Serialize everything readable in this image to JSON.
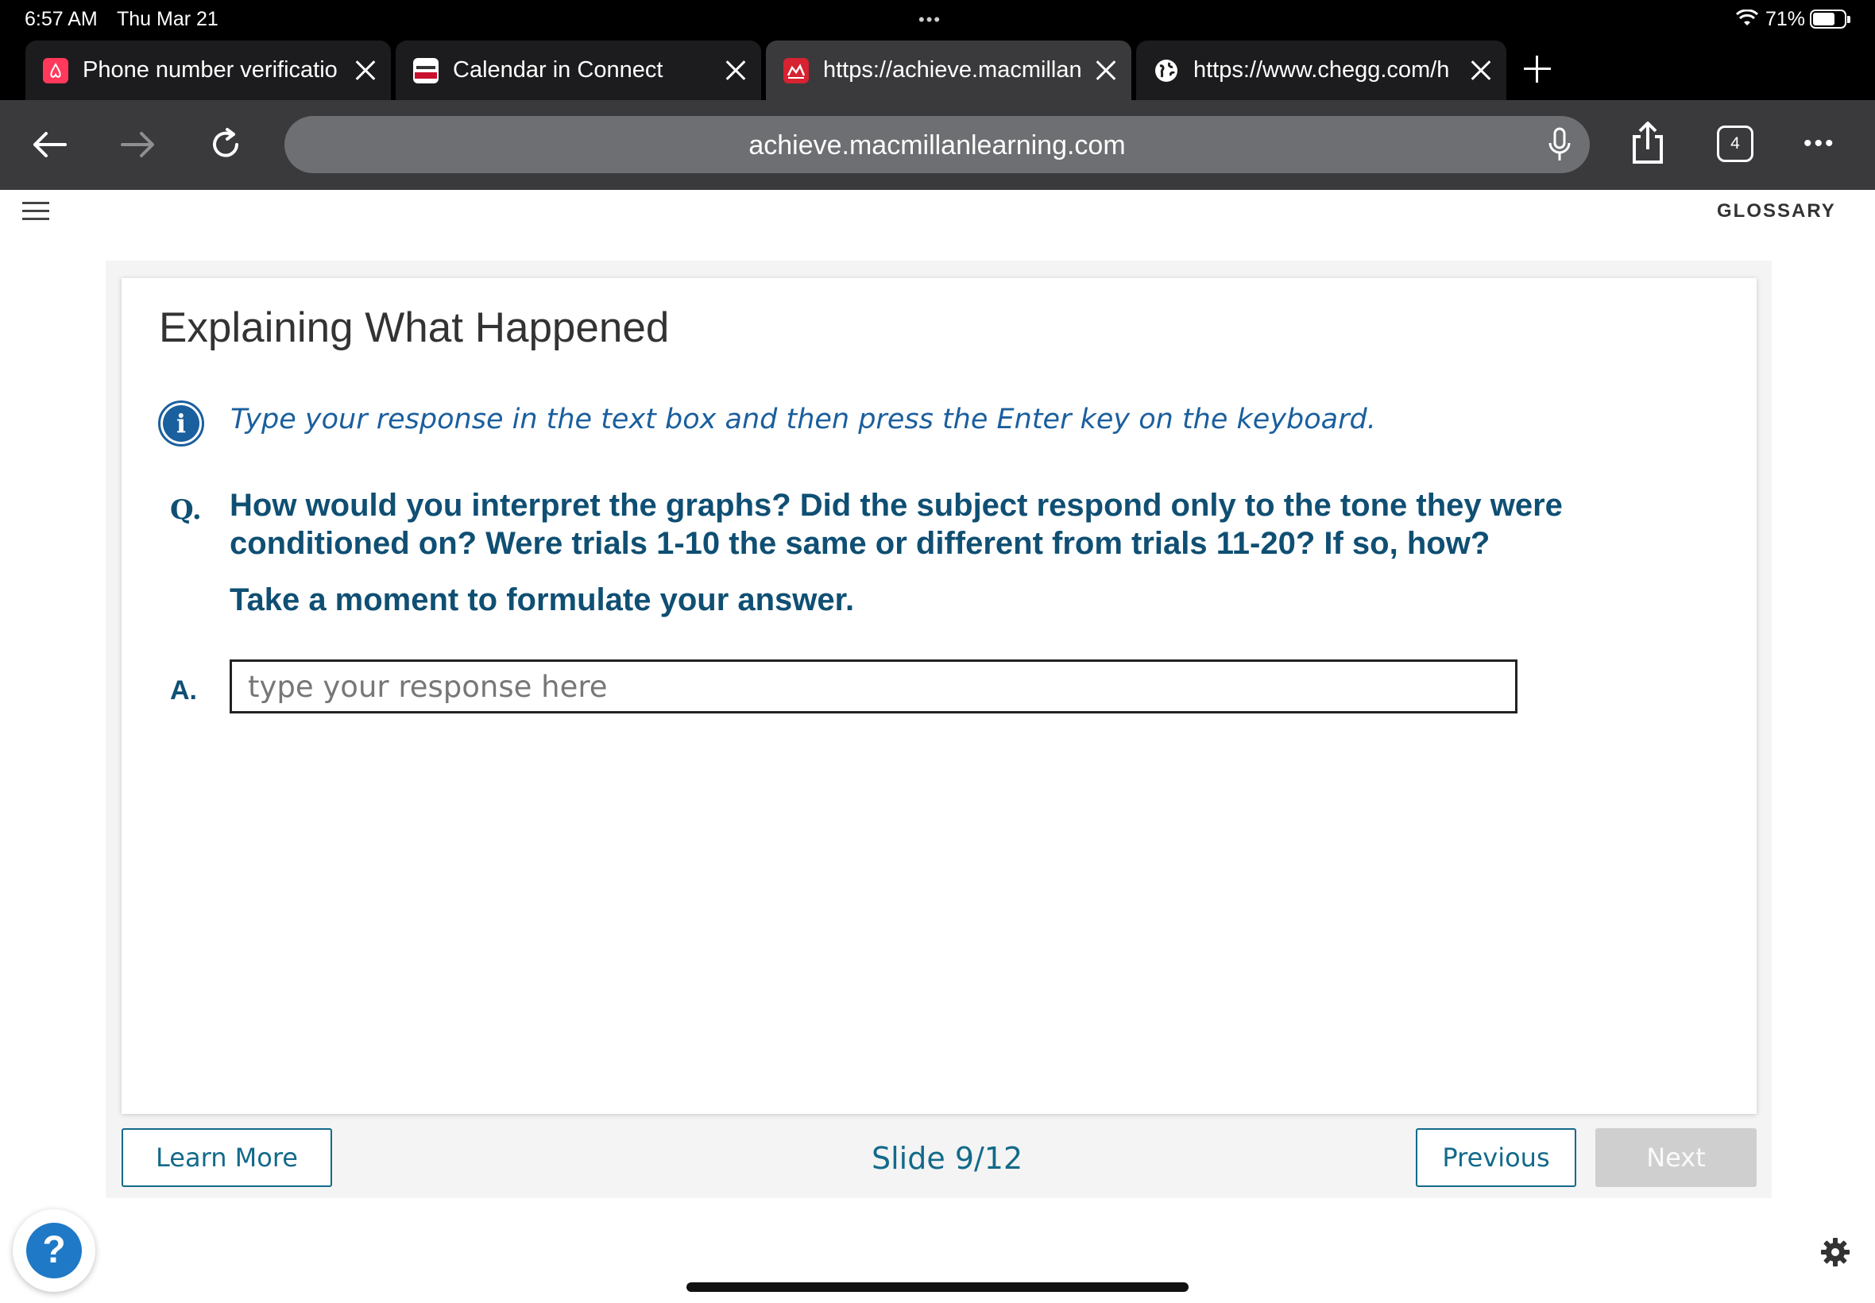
{
  "status_bar": {
    "time": "6:57 AM",
    "date": "Thu Mar 21",
    "center_dots": "•••",
    "battery_pct": "71%"
  },
  "tabs": [
    {
      "title": "Phone number verificatio",
      "icon": "airbnb-icon",
      "active": false
    },
    {
      "title": "Calendar in Connect",
      "icon": "connect-icon",
      "active": false
    },
    {
      "title": "https://achieve.macmillan",
      "icon": "macmillan-icon",
      "active": true
    },
    {
      "title": "https://www.chegg.com/h",
      "icon": "globe-icon",
      "active": false
    }
  ],
  "toolbar": {
    "url": "achieve.macmillanlearning.com",
    "tab_count": "4",
    "more": "•••"
  },
  "header": {
    "glossary": "GLOSSARY"
  },
  "card": {
    "title": "Explaining What Happened",
    "instruction": "Type your response in the text box and then press the Enter key on the keyboard.",
    "q_label": "Q.",
    "question": "How would you interpret the graphs? Did the subject respond only to the tone they were conditioned on? Were trials 1-10 the same or different from trials 11-20? If so, how?",
    "prompt": "Take a moment to formulate your answer.",
    "a_label": "A.",
    "answer_placeholder": "type your response here",
    "answer_value": ""
  },
  "footer": {
    "learn_more": "Learn More",
    "slide": "Slide 9/12",
    "previous": "Previous",
    "next": "Next"
  },
  "colors": {
    "question_text": "#0f4f73",
    "accent": "#136a8a",
    "info": "#1a5f9e",
    "next_disabled": "#cfcfcf"
  }
}
